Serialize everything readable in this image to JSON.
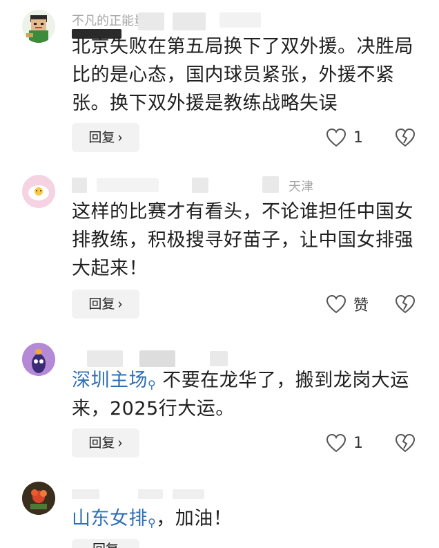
{
  "comments": [
    {
      "meta_name": "不凡的正能量",
      "text": "北京失败在第五局换下了双外援。决胜局比的是心态，国内球员紧张，外援不紧张。换下双外援是教练战略失误",
      "reply_label": "回复",
      "like_value": "1"
    },
    {
      "meta_location": "天津",
      "text": "这样的比赛才有看头，不论谁担任中国女排教练，积极搜寻好苗子，让中国女排强大起来！",
      "reply_label": "回复",
      "like_value": "赞"
    },
    {
      "topic": "深圳主场",
      "text": " 不要在龙华了，搬到龙岗大运来，2025行大运。",
      "reply_label": "回复",
      "like_value": "1"
    },
    {
      "topic": "山东女排",
      "text": "，加油！",
      "reply_label": "回复"
    }
  ],
  "icons": {
    "like": "heart-outline-icon",
    "dislike": "broken-heart-icon",
    "topic": "search-icon",
    "chevron": "chevron-right-icon"
  },
  "colors": {
    "topic_link": "#2f6fb3",
    "meta_text": "#a6a6a6",
    "reply_bg": "#f2f2f2"
  }
}
